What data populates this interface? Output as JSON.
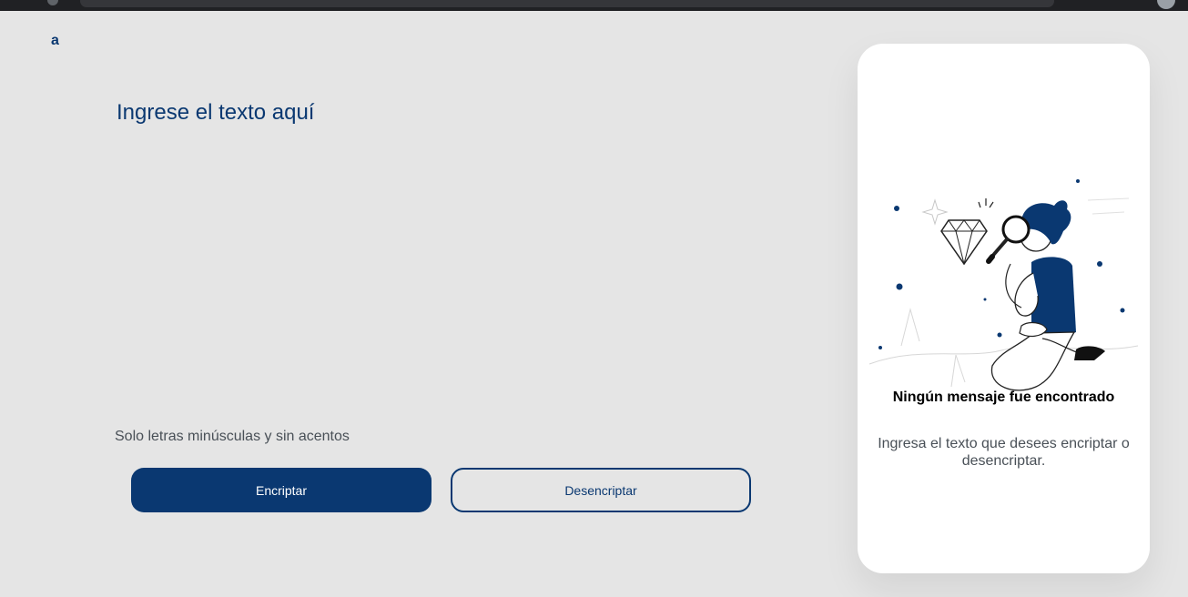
{
  "header": {
    "logo_text": "a"
  },
  "editor": {
    "placeholder": "Ingrese el texto aquí"
  },
  "hint": {
    "text": "Solo letras minúsculas y sin acentos"
  },
  "actions": {
    "encrypt_label": "Encriptar",
    "decrypt_label": "Desencriptar"
  },
  "output": {
    "title": "Ningún mensaje fue encontrado",
    "message": "Ingresa el texto que desees encriptar o desencriptar."
  },
  "colors": {
    "primary": "#0a3871",
    "background": "#e5e5e5",
    "card": "#ffffff",
    "muted_text": "#495057"
  },
  "icons": {
    "illustration": "person-with-magnifier-icon"
  }
}
